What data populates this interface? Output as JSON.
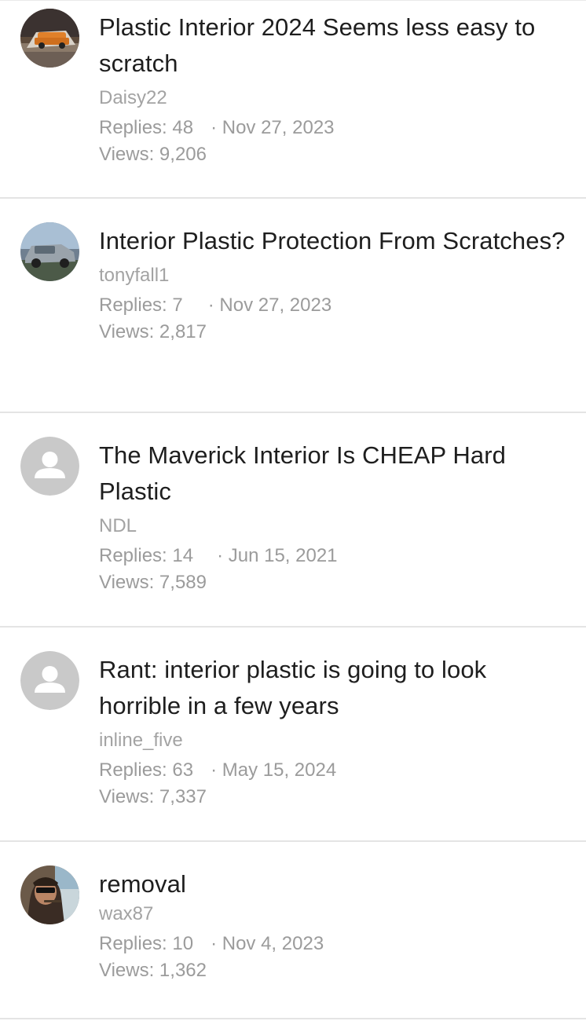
{
  "threads": [
    {
      "title": "Plastic Interior 2024 Seems less easy to scratch",
      "author": "Daisy22",
      "replies": "Replies: 48",
      "date": "· Nov 27, 2023",
      "views": "Views: 9,206",
      "avatar": "orange-truck-photo"
    },
    {
      "title": "Interior Plastic Protection From Scratches?",
      "author": "tonyfall1",
      "replies": "Replies: 7",
      "date": "· Nov 27, 2023",
      "views": "Views: 2,817",
      "avatar": "gray-truck-photo"
    },
    {
      "title": "The Maverick Interior Is CHEAP Hard Plastic",
      "author": "NDL",
      "replies": "Replies: 14",
      "date": "· Jun 15, 2021",
      "views": "Views: 7,589",
      "avatar": "default-user-icon"
    },
    {
      "title": "Rant: interior plastic is going to look horrible in a few years",
      "author": "inline_five",
      "replies": "Replies: 63",
      "date": "· May 15, 2024",
      "views": "Views: 7,337",
      "avatar": "default-user-icon"
    },
    {
      "title": "removal",
      "author": "wax87",
      "replies": "Replies: 10",
      "date": "· Nov 4, 2023",
      "views": "Views: 1,362",
      "avatar": "person-photo"
    }
  ],
  "colors": {
    "title": "#1e1e1e",
    "muted": "#9b9b9b",
    "divider": "#e4e4e4",
    "placeholder_avatar": "#c9c9c9"
  }
}
